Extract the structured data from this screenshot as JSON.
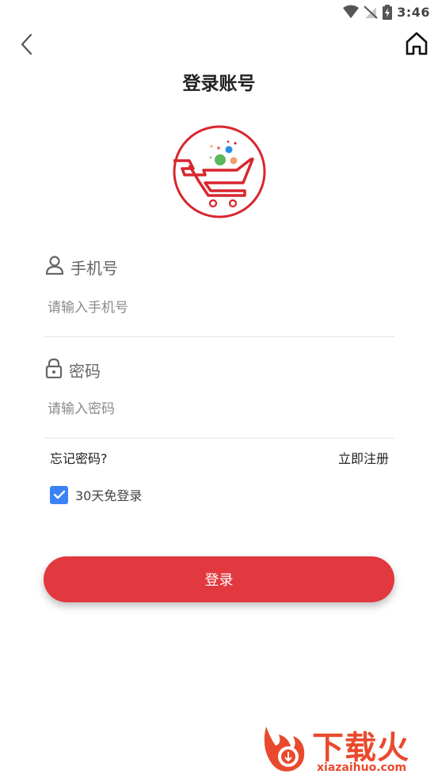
{
  "status_bar": {
    "time": "3:46"
  },
  "header": {
    "title": "登录账号"
  },
  "phone": {
    "label": "手机号",
    "placeholder": "请输入手机号",
    "value": ""
  },
  "password": {
    "label": "密码",
    "placeholder": "请输入密码",
    "value": ""
  },
  "links": {
    "forgot": "忘记密码?",
    "register": "立即注册"
  },
  "remember": {
    "label": "30天免登录",
    "checked": true
  },
  "login_button": {
    "label": "登录"
  },
  "watermark": {
    "brand": "下载火",
    "domain": "xiazaihuo.com"
  },
  "colors": {
    "accent": "#e2383f",
    "checkbox": "#3b82f6",
    "logo_red": "#d8262e"
  }
}
